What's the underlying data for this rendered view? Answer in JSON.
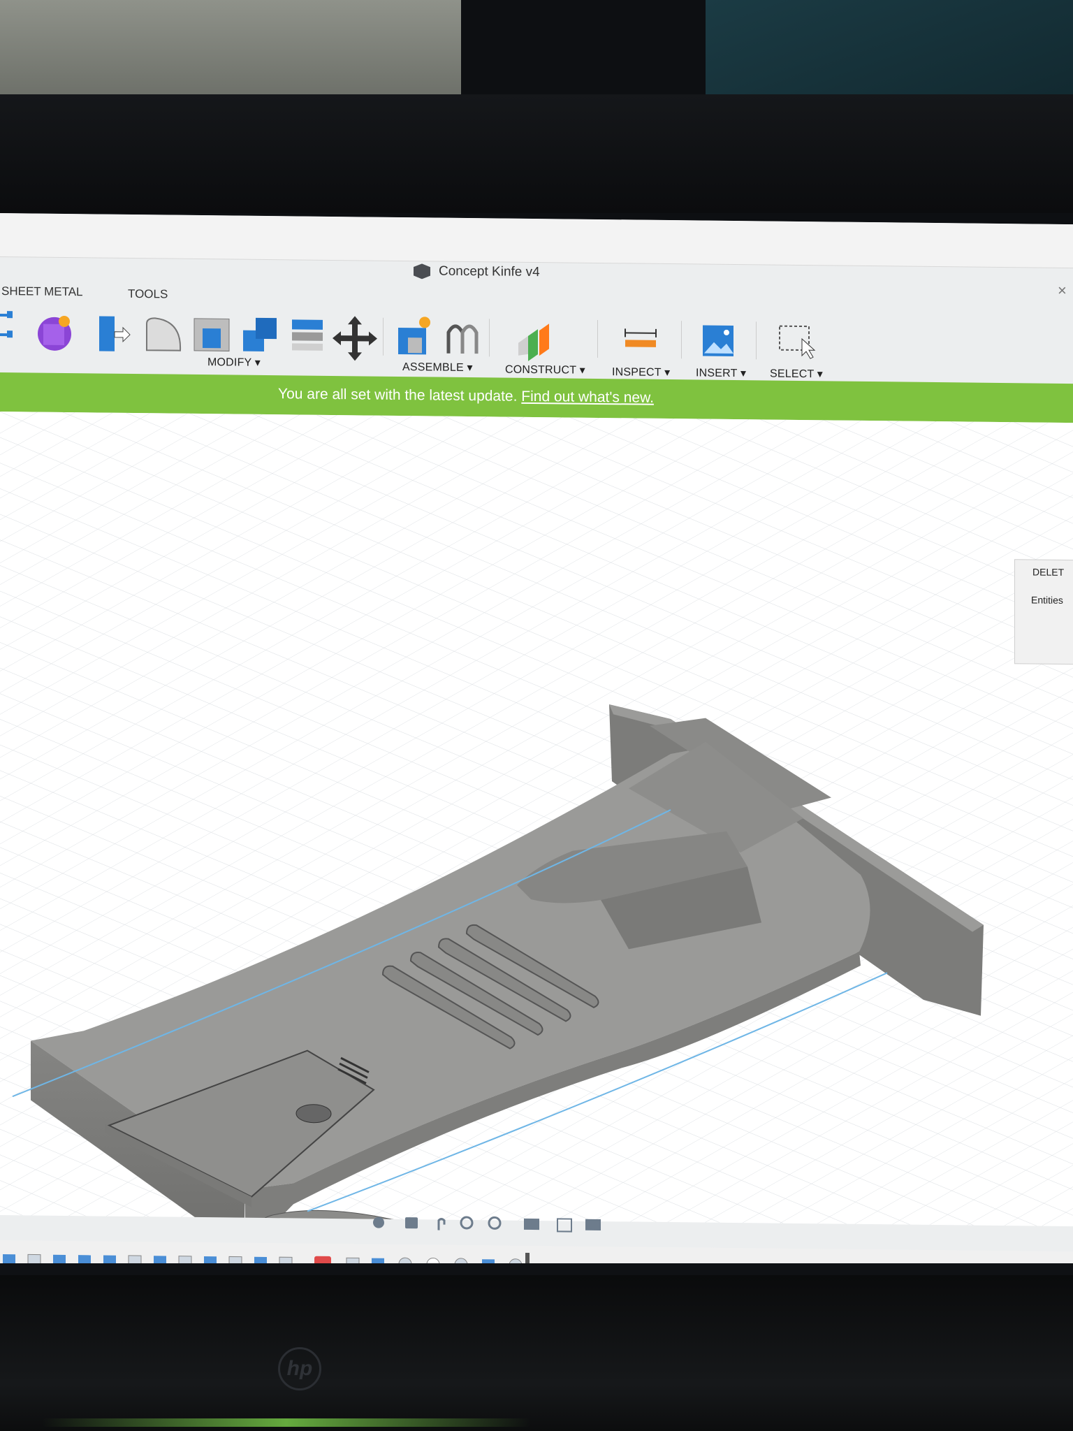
{
  "window": {
    "title": "Concept Kinfe v4",
    "close_symbol": "×"
  },
  "tabs": {
    "sheet_metal": "SHEET METAL",
    "tools": "TOOLS"
  },
  "toolbar": {
    "modify": "MODIFY ▾",
    "assemble": "ASSEMBLE ▾",
    "construct": "CONSTRUCT ▾",
    "inspect": "INSPECT ▾",
    "insert": "INSERT ▾",
    "select": "SELECT ▾"
  },
  "banner": {
    "text": "You are all set with the latest update.",
    "link": "Find out what's new.",
    "color": "#7fc23f"
  },
  "side_panel": {
    "title": "DELET",
    "entities_label": "Entities"
  },
  "brand": {
    "logo": "hp"
  },
  "colors": {
    "model": "#8e8e8c",
    "grid": "#d4d8dc",
    "sketch_line": "#6fb6e6"
  },
  "icons": [
    "sheet-metal-icon",
    "create-solid-icon",
    "press-pull-icon",
    "fillet-icon",
    "shell-icon",
    "combine-icon",
    "replace-face-icon",
    "move-icon",
    "new-component-icon",
    "joint-icon",
    "offset-plane-icon",
    "measure-icon",
    "insert-image-icon",
    "select-box-icon"
  ]
}
